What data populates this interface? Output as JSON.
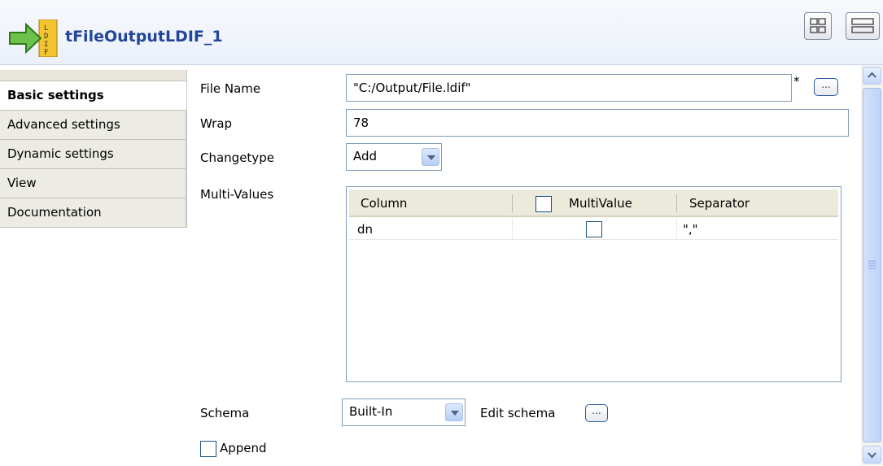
{
  "header": {
    "title": "tFileOutputLDIF_1"
  },
  "tabs": [
    {
      "label": "Basic settings",
      "active": true
    },
    {
      "label": "Advanced settings"
    },
    {
      "label": "Dynamic settings"
    },
    {
      "label": "View"
    },
    {
      "label": "Documentation"
    }
  ],
  "form": {
    "file_name_label": "File Name",
    "file_name_value": "\"C:/Output/File.ldif\"",
    "required_marker": "*",
    "browse_label": "...",
    "wrap_label": "Wrap",
    "wrap_value": "78",
    "changetype_label": "Changetype",
    "changetype_value": "Add",
    "multivalues_label": "Multi-Values",
    "schema_label": "Schema",
    "schema_value": "Built-In",
    "edit_schema_label": "Edit schema",
    "edit_schema_button": "...",
    "append_label": "Append"
  },
  "table": {
    "columns": [
      "Column",
      "MultiValue",
      "Separator"
    ],
    "rows": [
      {
        "column": "dn",
        "multivalue": false,
        "separator": "\",\""
      }
    ]
  },
  "colors": {
    "title": "#21469a",
    "border": "#7f9db9"
  }
}
